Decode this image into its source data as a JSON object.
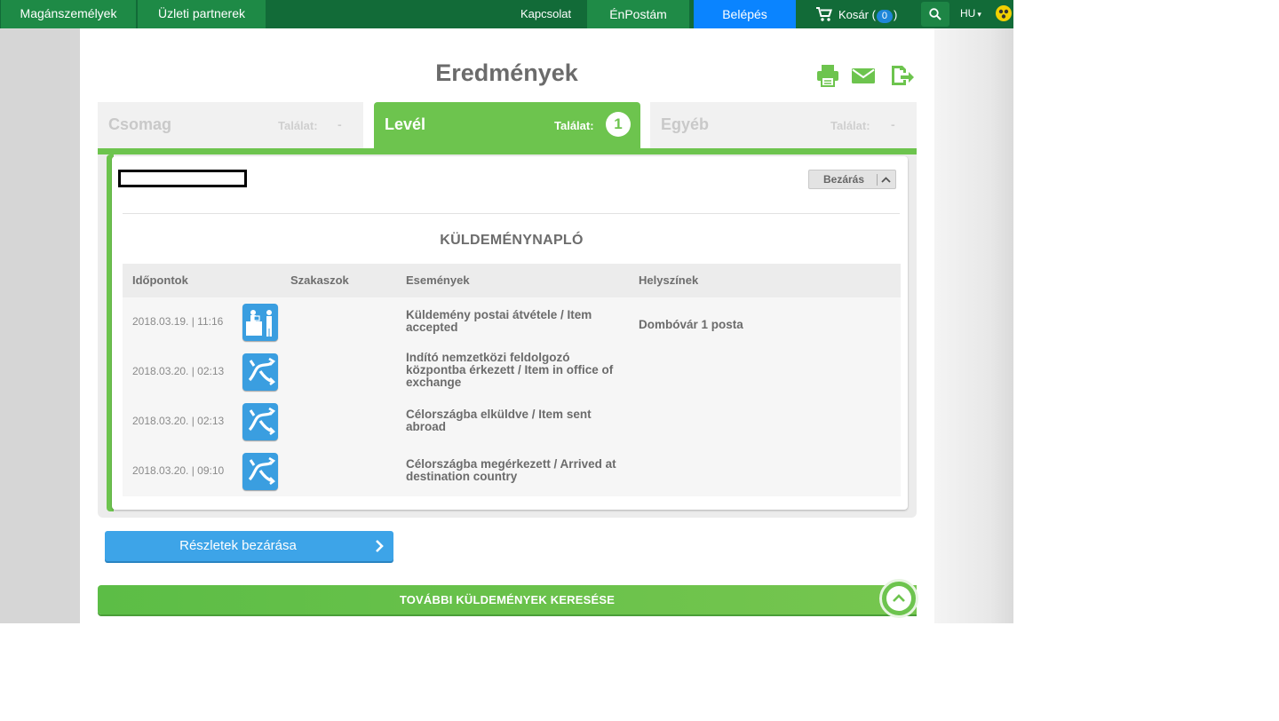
{
  "topbar": {
    "segments": [
      "Magánszemélyek",
      "Üzleti partnerek"
    ],
    "contact": "Kapcsolat",
    "enpostam": "ÉnPostám",
    "login": "Belépés",
    "cart_prefix": "Kosár (",
    "cart_count": "0",
    "cart_suffix": ")",
    "lang": "HU",
    "lang_caret": "▾"
  },
  "page": {
    "title": "Eredmények",
    "icons": [
      "print-icon",
      "email-icon",
      "export-icon"
    ]
  },
  "tabs": [
    {
      "title": "Csomag",
      "hits_label": "Találat:",
      "hits": "-",
      "active": false
    },
    {
      "title": "Levél",
      "hits_label": "Találat:",
      "hits": "1",
      "active": true
    },
    {
      "title": "Egyéb",
      "hits_label": "Találat:",
      "hits": "-",
      "active": false
    }
  ],
  "panel": {
    "close_button": "Bezárás",
    "log_title": "KÜLDEMÉNYNAPLÓ",
    "columns": [
      "Időpontok",
      "Szakaszok",
      "Események",
      "Helyszínek"
    ],
    "rows": [
      {
        "date": "2018.03.19. | 11:16",
        "icon": "post-office-counter-icon",
        "event": "Küldemény postai átvétele / Item accepted",
        "place": "Dombóvár 1 posta"
      },
      {
        "date": "2018.03.20. | 02:13",
        "icon": "routing-arrows-icon",
        "event": "Indító nemzetközi feldolgozó központba érkezett / Item in office of exchange",
        "place": ""
      },
      {
        "date": "2018.03.20. | 02:13",
        "icon": "routing-arrows-icon",
        "event": "Célországba elküldve / Item sent abroad",
        "place": ""
      },
      {
        "date": "2018.03.20. | 09:10",
        "icon": "routing-arrows-icon",
        "event": "Célországba megérkezett / Arrived at destination country",
        "place": ""
      }
    ]
  },
  "actions": {
    "details_close": "Részletek bezárása",
    "more_search": "TOVÁBBI KÜLDEMÉNYEK KERESÉSE"
  },
  "colors": {
    "brand_dark": "#126b38",
    "brand_green": "#6dc44e",
    "accent_blue": "#3da4e8",
    "login_blue": "#0a84ff"
  }
}
